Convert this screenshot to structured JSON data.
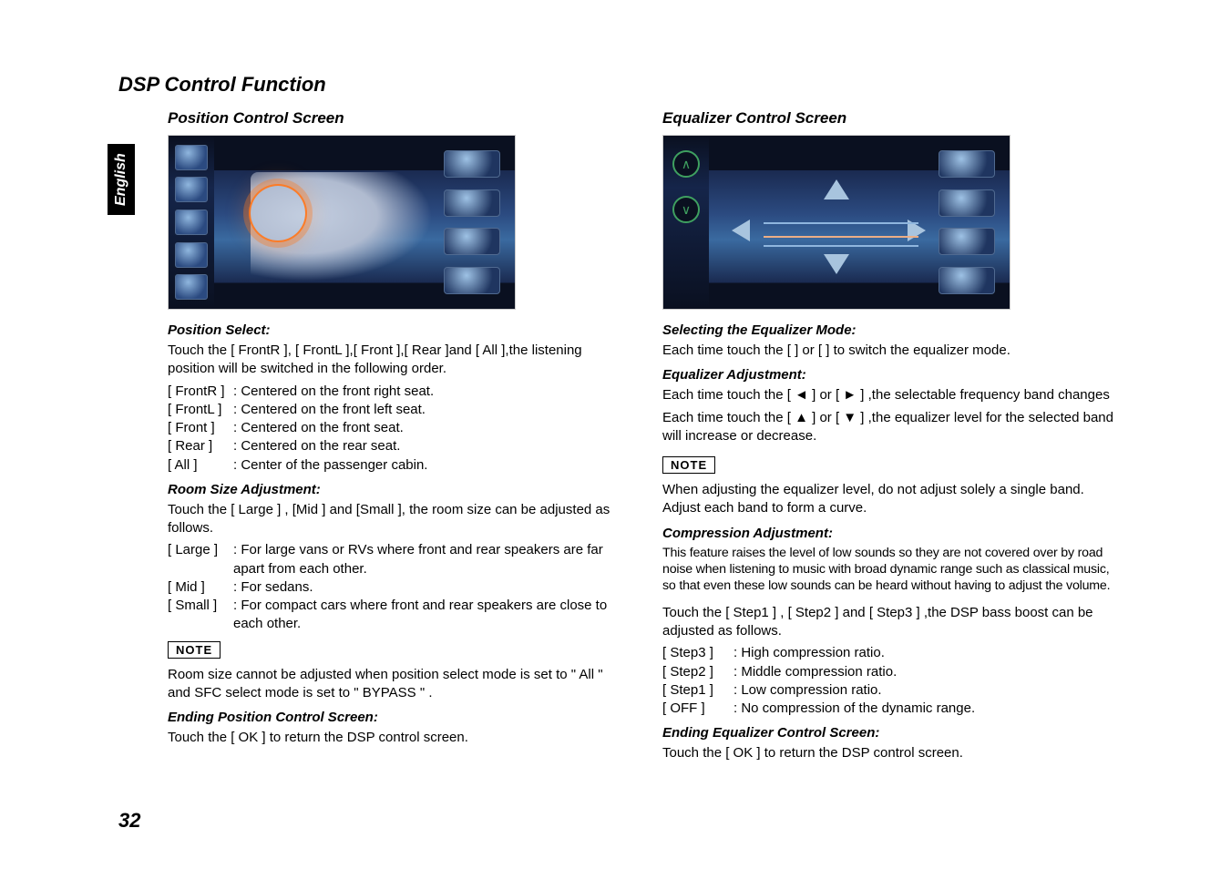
{
  "lang_tab": "English",
  "section_title": "DSP Control Function",
  "page_number": "32",
  "left": {
    "subtitle": "Position Control Screen",
    "posSelect": {
      "heading": "Position Select:",
      "intro": "Touch the [ FrontR ], [ FrontL ],[ Front  ],[ Rear ]and [ All ],the listening position will be switched in the following order.",
      "rows": [
        {
          "label": "[ FrontR ]",
          "text": ": Centered on the front right seat."
        },
        {
          "label": "[ FrontL ]",
          "text": ": Centered on the front left seat."
        },
        {
          "label": "[ Front ]",
          "text": ": Centered on the front seat."
        },
        {
          "label": "[ Rear ]",
          "text": ": Centered on the rear seat."
        },
        {
          "label": "[ All ]",
          "text": ": Center of the passenger cabin."
        }
      ]
    },
    "roomSize": {
      "heading": "Room Size Adjustment:",
      "intro": "Touch the [ Large ] , [Mid ] and [Small ], the room size can be adjusted as follows.",
      "rows": [
        {
          "label": "[ Large ]",
          "text": ": For large vans or RVs where front and rear speakers are far apart from each other."
        },
        {
          "label": "[ Mid ]",
          "text": ": For sedans."
        },
        {
          "label": "[ Small ]",
          "text": ": For compact cars where front and rear speakers are close to each other."
        }
      ]
    },
    "note_label": "NOTE",
    "note_text": "Room size cannot be adjusted when position select mode is set to \" All \" and SFC select mode is set to \" BYPASS \" .",
    "ending": {
      "heading": "Ending Position Control Screen:",
      "text": "Touch the [ OK ] to return the DSP control screen."
    }
  },
  "right": {
    "subtitle": "Equalizer Control Screen",
    "selectMode": {
      "heading": "Selecting the Equalizer Mode:",
      "text": "Each time touch the [     ] or [    ] to switch the equalizer mode."
    },
    "eqAdjust": {
      "heading": "Equalizer Adjustment:",
      "line1_a": "Each time touch the [ ",
      "sym_left": "◄",
      "line1_b": " ] or [ ",
      "sym_right": "►",
      "line1_c": " ] ,the selectable frequency band changes",
      "line2_a": "Each time touch the [ ",
      "sym_up": "▲",
      "line2_b": " ] or [ ",
      "sym_down": "▼",
      "line2_c": " ] ,the equalizer level for the selected band will increase or decrease."
    },
    "note_label": "NOTE",
    "note_text": "When adjusting the equalizer level, do not adjust solely a single band. Adjust each band to form a curve.",
    "compression": {
      "heading": "Compression Adjustment:",
      "desc": "This feature raises the level of low sounds so they are not covered over by road noise when listening to music with broad dynamic range such as classical music, so that even these low sounds can be heard without having to adjust the volume.",
      "intro": "Touch the [ Step1 ] , [ Step2 ] and [ Step3 ] ,the DSP bass boost can be adjusted as follows.",
      "rows": [
        {
          "label": "[ Step3 ]",
          "text": ": High compression ratio."
        },
        {
          "label": "[ Step2 ]",
          "text": ": Middle compression ratio."
        },
        {
          "label": "[ Step1 ]",
          "text": ": Low compression ratio."
        },
        {
          "label": "[ OFF  ]",
          "text": ": No compression of the dynamic range."
        }
      ]
    },
    "ending": {
      "heading": "Ending Equalizer Control Screen:",
      "text": "Touch the [ OK ] to return the DSP control screen."
    }
  }
}
